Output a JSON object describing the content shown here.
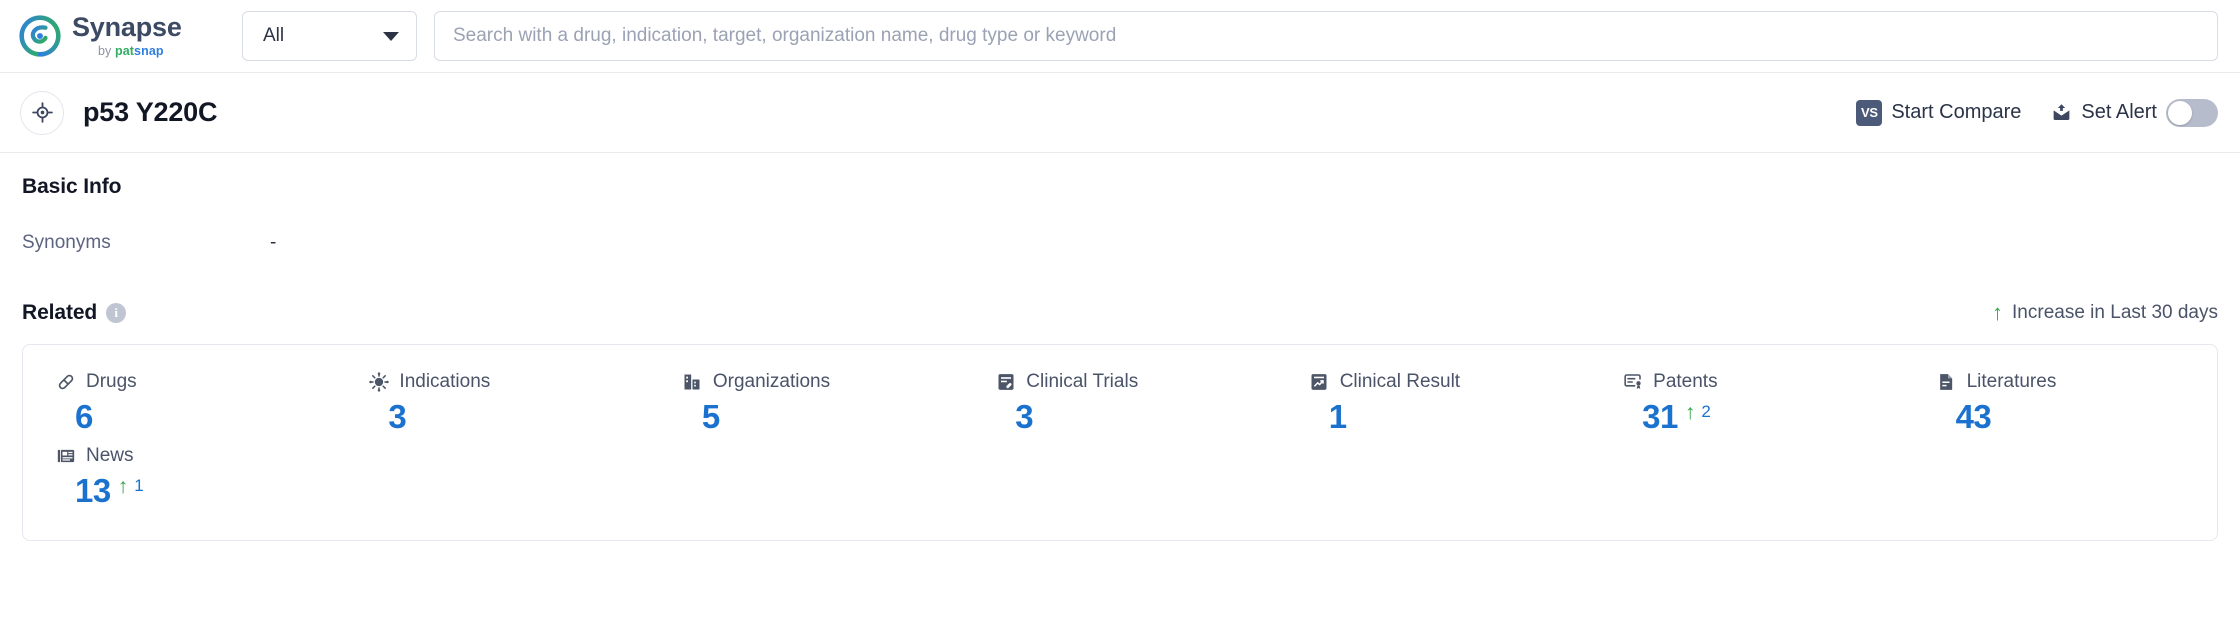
{
  "brand": {
    "name": "Synapse",
    "by": "by",
    "pat": "pat",
    "snap": "snap",
    "logo_colors": {
      "blue": "#2f7fe0",
      "green": "#2fae5f"
    }
  },
  "search": {
    "scope_selected": "All",
    "placeholder": "Search with a drug, indication, target, organization name, drug type or keyword",
    "value": ""
  },
  "entity": {
    "title": "p53 Y220C",
    "icon": "target-icon",
    "actions": {
      "compare_label": "Start Compare",
      "compare_badge": "VS",
      "alert_label": "Set Alert",
      "alert_toggle_on": false
    }
  },
  "basic_info": {
    "title": "Basic Info",
    "rows": [
      {
        "key": "Synonyms",
        "value": "-"
      }
    ]
  },
  "related": {
    "title": "Related",
    "info_icon": "info-icon",
    "info_glyph": "i",
    "increase_note": "Increase in Last 30 days",
    "increase_arrow": "↑",
    "accent_color": "#1b72ce",
    "increase_color": "#31a84a",
    "items": [
      {
        "label": "Drugs",
        "icon": "pill-icon",
        "value": "6",
        "delta": null
      },
      {
        "label": "Indications",
        "icon": "virus-icon",
        "value": "3",
        "delta": null
      },
      {
        "label": "Organizations",
        "icon": "building-icon",
        "value": "5",
        "delta": null
      },
      {
        "label": "Clinical Trials",
        "icon": "clipboard-pill-icon",
        "value": "3",
        "delta": null
      },
      {
        "label": "Clinical Result",
        "icon": "chart-document-icon",
        "value": "1",
        "delta": null
      },
      {
        "label": "Patents",
        "icon": "certificate-icon",
        "value": "31",
        "delta": "2"
      },
      {
        "label": "Literatures",
        "icon": "document-icon",
        "value": "43",
        "delta": null
      },
      {
        "label": "News",
        "icon": "newspaper-icon",
        "value": "13",
        "delta": "1"
      }
    ]
  }
}
